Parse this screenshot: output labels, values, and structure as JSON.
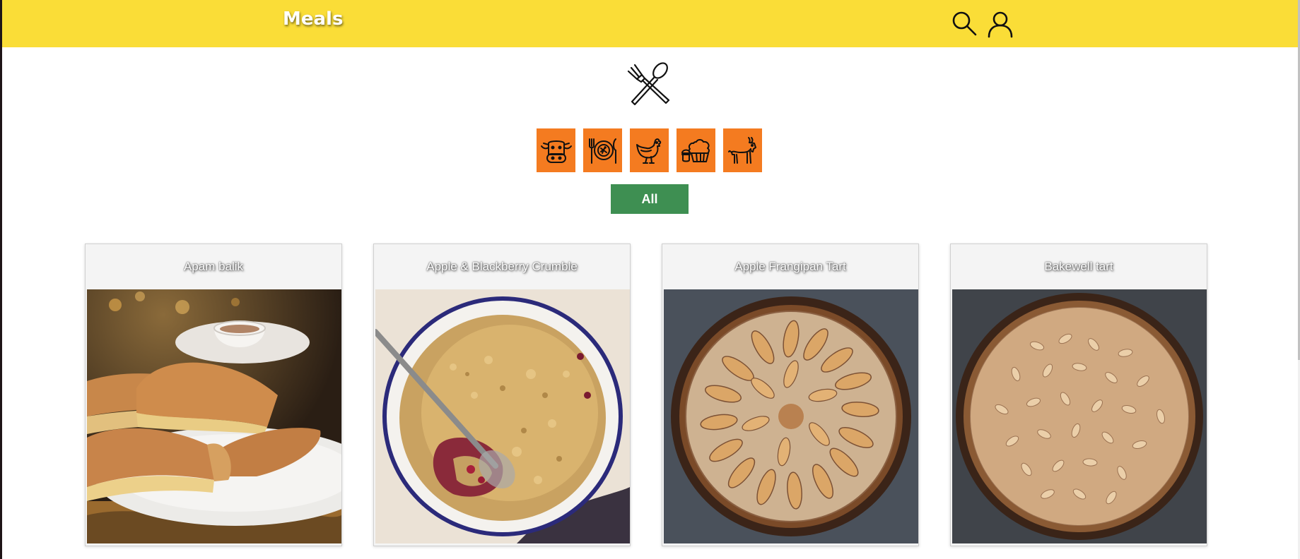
{
  "header": {
    "brand": "Meals",
    "icons": [
      "search-icon",
      "user-icon"
    ],
    "background": "#fadd37"
  },
  "logo": {
    "icon": "fork-spoon-icon"
  },
  "categories": [
    {
      "icon": "cow-icon"
    },
    {
      "icon": "plate-icon"
    },
    {
      "icon": "chicken-icon"
    },
    {
      "icon": "dessert-icon"
    },
    {
      "icon": "goat-icon"
    }
  ],
  "filter": {
    "all_label": "All",
    "color": "#3e8f52"
  },
  "accent": "#f47b20",
  "meals": [
    {
      "title": "Apam balik"
    },
    {
      "title": "Apple & Blackberry Crumble"
    },
    {
      "title": "Apple Frangipan Tart"
    },
    {
      "title": "Bakewell tart"
    }
  ]
}
